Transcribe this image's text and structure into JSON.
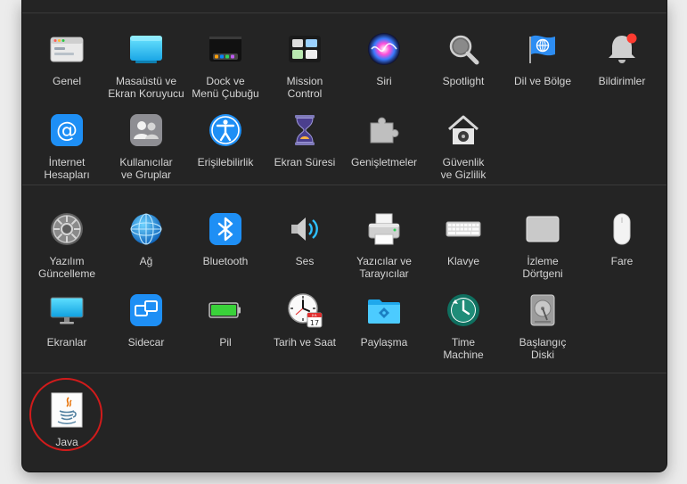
{
  "sections": [
    {
      "items": [
        {
          "id": "genel",
          "label": "Genel",
          "icon": "general-icon"
        },
        {
          "id": "masaustu",
          "label": "Masaüstü ve\nEkran Koruyucu",
          "icon": "desktop-screensaver-icon"
        },
        {
          "id": "dock",
          "label": "Dock ve\nMenü Çubuğu",
          "icon": "dock-menubar-icon"
        },
        {
          "id": "mission",
          "label": "Mission\nControl",
          "icon": "mission-control-icon"
        },
        {
          "id": "siri",
          "label": "Siri",
          "icon": "siri-icon"
        },
        {
          "id": "spotlight",
          "label": "Spotlight",
          "icon": "spotlight-icon"
        },
        {
          "id": "dil",
          "label": "Dil ve Bölge",
          "icon": "language-region-icon"
        },
        {
          "id": "bildirimler",
          "label": "Bildirimler",
          "icon": "notifications-icon"
        },
        {
          "id": "internet",
          "label": "İnternet\nHesapları",
          "icon": "internet-accounts-icon"
        },
        {
          "id": "kullanicilar",
          "label": "Kullanıcılar\nve Gruplar",
          "icon": "users-groups-icon"
        },
        {
          "id": "erisilebilirlik",
          "label": "Erişilebilirlik",
          "icon": "accessibility-icon"
        },
        {
          "id": "ekransuresi",
          "label": "Ekran Süresi",
          "icon": "screen-time-icon"
        },
        {
          "id": "genisletmeler",
          "label": "Genişletmeler",
          "icon": "extensions-icon"
        },
        {
          "id": "guvenlik",
          "label": "Güvenlik\nve Gizlilik",
          "icon": "security-privacy-icon"
        }
      ]
    },
    {
      "items": [
        {
          "id": "yazilim",
          "label": "Yazılım\nGüncelleme",
          "icon": "software-update-icon"
        },
        {
          "id": "ag",
          "label": "Ağ",
          "icon": "network-icon"
        },
        {
          "id": "bluetooth",
          "label": "Bluetooth",
          "icon": "bluetooth-icon"
        },
        {
          "id": "ses",
          "label": "Ses",
          "icon": "sound-icon"
        },
        {
          "id": "yazicilar",
          "label": "Yazıcılar ve\nTarayıcılar",
          "icon": "printers-scanners-icon"
        },
        {
          "id": "klavye",
          "label": "Klavye",
          "icon": "keyboard-icon"
        },
        {
          "id": "izleme",
          "label": "İzleme\nDörtgeni",
          "icon": "trackpad-icon"
        },
        {
          "id": "fare",
          "label": "Fare",
          "icon": "mouse-icon"
        },
        {
          "id": "ekranlar",
          "label": "Ekranlar",
          "icon": "displays-icon"
        },
        {
          "id": "sidecar",
          "label": "Sidecar",
          "icon": "sidecar-icon"
        },
        {
          "id": "pil",
          "label": "Pil",
          "icon": "battery-icon"
        },
        {
          "id": "tarih",
          "label": "Tarih ve Saat",
          "icon": "date-time-icon",
          "calendar_month": "JUL",
          "calendar_day": "17"
        },
        {
          "id": "paylasma",
          "label": "Paylaşma",
          "icon": "sharing-icon"
        },
        {
          "id": "timemachine",
          "label": "Time\nMachine",
          "icon": "time-machine-icon"
        },
        {
          "id": "baslangic",
          "label": "Başlangıç\nDiski",
          "icon": "startup-disk-icon"
        }
      ]
    },
    {
      "items": [
        {
          "id": "java",
          "label": "Java",
          "icon": "java-icon",
          "highlighted": true
        }
      ]
    }
  ],
  "colors": {
    "window_bg": "#242424",
    "separator": "#3a3a3a",
    "label": "#d4d4d4",
    "highlight_ring": "#d11b1b",
    "notification_badge": "#ff3b30"
  }
}
